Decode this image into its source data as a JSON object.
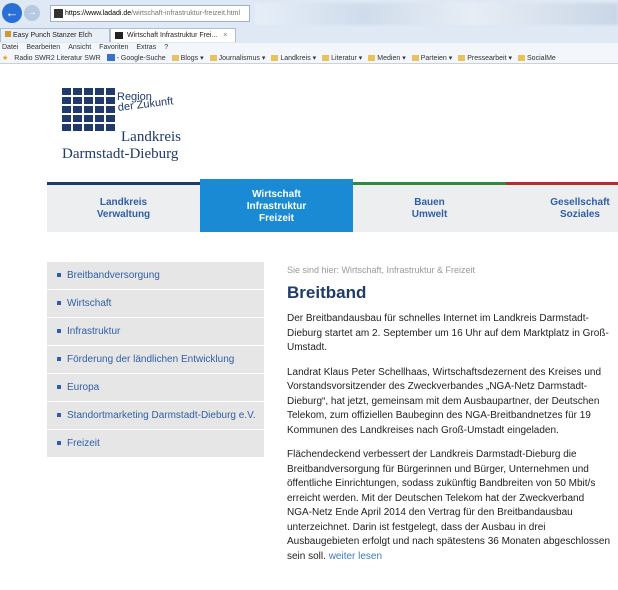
{
  "browser": {
    "url_host": "https://www.ladadi.de",
    "url_path": "/wirtschaft-infrastruktur-freizeit.html",
    "tabs": [
      {
        "label": "Easy Punch Stanzer Elch"
      },
      {
        "label": "Wirtschaft Infrastruktur Frei...",
        "close": "×"
      }
    ],
    "menu": [
      "Datei",
      "Bearbeiten",
      "Ansicht",
      "Favoriten",
      "Extras",
      "?"
    ],
    "favorites": [
      "Radio SWR2 Literatur SWR",
      "- Google-Suche",
      "Blogs ▾",
      "Journalismus ▾",
      "Landkreis ▾",
      "Literatur ▾",
      "Medien ▾",
      "Parteien ▾",
      "Pressearbeit ▾",
      "SocialMe"
    ]
  },
  "logo": {
    "tag_line1": "Region",
    "tag_line2": "der Zukunft",
    "kreis": "Landkreis",
    "name": "Darmstadt-Dieburg"
  },
  "nav": [
    {
      "line1": "Landkreis",
      "line2": "Verwaltung",
      "line3": ""
    },
    {
      "line1": "Wirtschaft",
      "line2": "Infrastruktur",
      "line3": "Freizeit"
    },
    {
      "line1": "Bauen",
      "line2": "Umwelt",
      "line3": ""
    },
    {
      "line1": "Gesellschaft",
      "line2": "Soziales",
      "line3": ""
    }
  ],
  "sidebar": {
    "items": [
      {
        "label": "Breitbandversorgung"
      },
      {
        "label": "Wirtschaft"
      },
      {
        "label": "Infrastruktur"
      },
      {
        "label": "Förderung der ländlichen Entwicklung"
      },
      {
        "label": "Europa"
      },
      {
        "label": "Standortmarketing Darmstadt-Dieburg e.V."
      },
      {
        "label": "Freizeit"
      }
    ]
  },
  "main": {
    "breadcrumb": "Sie sind hier: Wirtschaft, Infrastruktur & Freizeit",
    "title": "Breitband",
    "p1": "Der Breitbandausbau für schnelles Internet im Landkreis Darmstadt-Dieburg startet am 2. September  um 16 Uhr auf dem Marktplatz in Groß-Umstadt.",
    "p2": "Landrat Klaus Peter Schellhaas, Wirtschaftsdezernent des Kreises und Vorstandsvorsitzender des Zweckverbandes „NGA-Netz Darmstadt-Dieburg“, hat jetzt, gemeinsam mit dem Ausbaupartner, der Deutschen Telekom, zum offiziellen Baubeginn des NGA-Breitbandnetzes für 19 Kommunen des Landkreises nach Groß-Umstadt eingeladen.",
    "p3": "Flächendeckend verbessert der Landkreis Darmstadt-Dieburg die Breitbandversorgung für Bürgerinnen und Bürger, Unternehmen und öffentliche Einrichtungen, sodass zukünftig Bandbreiten von 50 Mbit/s erreicht werden. Mit der Deutschen Telekom hat der Zweckverband NGA-Netz Ende April 2014 den Vertrag für den Breitbandausbau unterzeichnet. Darin ist festgelegt, dass der Ausbau in drei Ausbaugebieten erfolgt und nach spätestens 36 Monaten abgeschlossen sein soll.",
    "more": "weiter lesen"
  }
}
